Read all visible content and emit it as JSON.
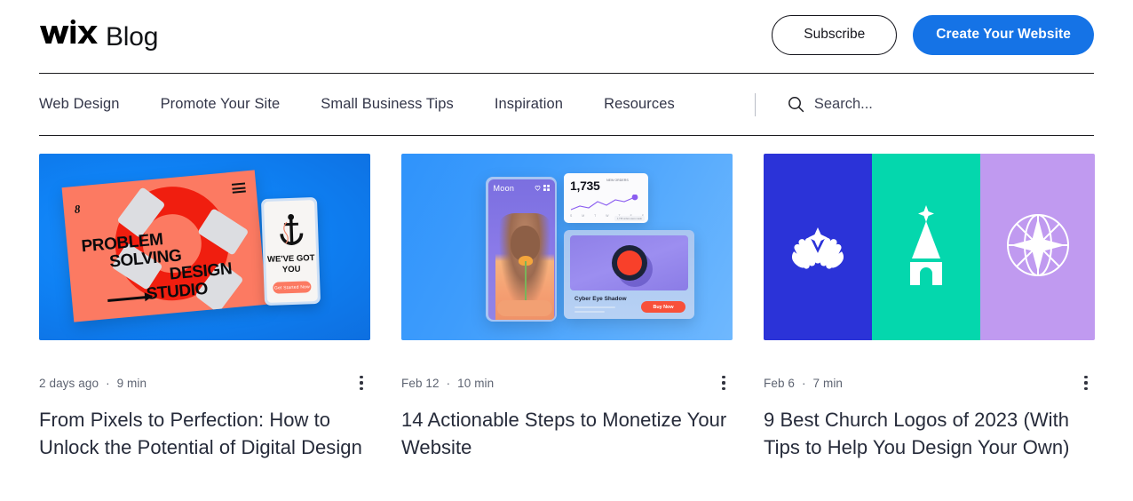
{
  "header": {
    "brand_mark": "wix-logo",
    "brand_word": "Blog",
    "subscribe_label": "Subscribe",
    "cta_label": "Create Your Website",
    "cta_color": "#1573e6"
  },
  "nav": {
    "items": [
      {
        "label": "Web Design",
        "name": "nav-item-web-design"
      },
      {
        "label": "Promote Your Site",
        "name": "nav-item-promote-your-site"
      },
      {
        "label": "Small Business Tips",
        "name": "nav-item-small-business-tips"
      },
      {
        "label": "Inspiration",
        "name": "nav-item-inspiration"
      },
      {
        "label": "Resources",
        "name": "nav-item-resources"
      }
    ],
    "search_icon": "search-icon",
    "search_label": "Search..."
  },
  "posts": [
    {
      "date": "2 days ago",
      "separator": "·",
      "read_time": "9 min",
      "title": "From Pixels to Perfection: How to Unlock the Potential of Digital Design",
      "menu_icon": "more-options-icon",
      "image": {
        "alt": "design-studio-poster",
        "background": "#0f82f5",
        "poster_color": "#fc7a62",
        "poster_text_1": "PROBLEM",
        "poster_text_2": "SOLVING",
        "poster_text_3": "DESIGN",
        "poster_text_4": "STUDIO",
        "phone_text": "WE'VE GOT YOU",
        "phone_button": "Get Started Now"
      }
    },
    {
      "date": "Feb 12",
      "separator": "·",
      "read_time": "10 min",
      "title": "14 Actionable Steps to Monetize Your Website",
      "menu_icon": "more-options-icon",
      "image": {
        "alt": "ecommerce-mockups",
        "background": "#3f9dfc",
        "phone_brand": "Moon",
        "stat_number": "1,735",
        "stat_label": "NEW ORDERS",
        "axis_labels": [
          "S",
          "M",
          "T",
          "W",
          "T",
          "F",
          "S"
        ],
        "tooltip": "1,735 orders were made",
        "product_name": "Cyber Eye Shadow",
        "product_button": "Buy Now"
      }
    },
    {
      "date": "Feb 6",
      "separator": "·",
      "read_time": "7 min",
      "title": "9 Best Church Logos of 2023 (With Tips to Help You Design Your Own)",
      "menu_icon": "more-options-icon",
      "image": {
        "alt": "church-logo-panels",
        "panel_1_color": "#2b33d8",
        "panel_1_icon": "praying-hands-icon",
        "panel_2_color": "#04d7ad",
        "panel_2_icon": "church-steeple-icon",
        "panel_3_color": "#c09af0",
        "panel_3_icon": "compass-star-icon"
      }
    }
  ]
}
